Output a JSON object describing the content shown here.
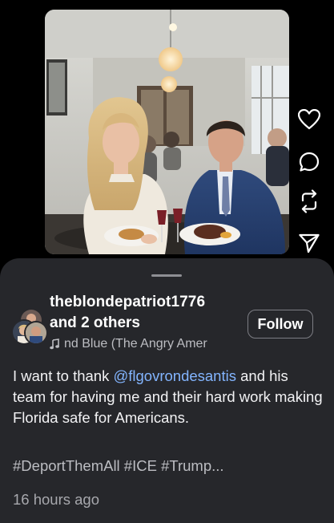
{
  "post": {
    "username": "theblondepatriot1776",
    "collaborators_prefix": "and",
    "collaborators_count": "2 others",
    "audio_title": "nd Blue (The Angry Amer",
    "follow_label": "Follow",
    "caption_text": "I want to thank ",
    "caption_mention": "@flgovrondesantis",
    "caption_rest": " and his team for having me and their hard work making Florida safe for Americans.",
    "hashtags": "#DeportThemAll #ICE #Trump...",
    "timestamp": "16 hours ago"
  },
  "actions": [
    {
      "icon": "heart-icon"
    },
    {
      "icon": "comment-icon"
    },
    {
      "icon": "repost-icon"
    },
    {
      "icon": "share-icon"
    }
  ],
  "colors": {
    "background": "#000000",
    "sheet": "#26272b",
    "mention": "#83b5ff",
    "text": "#ffffff",
    "muted": "#bcbdc2"
  }
}
